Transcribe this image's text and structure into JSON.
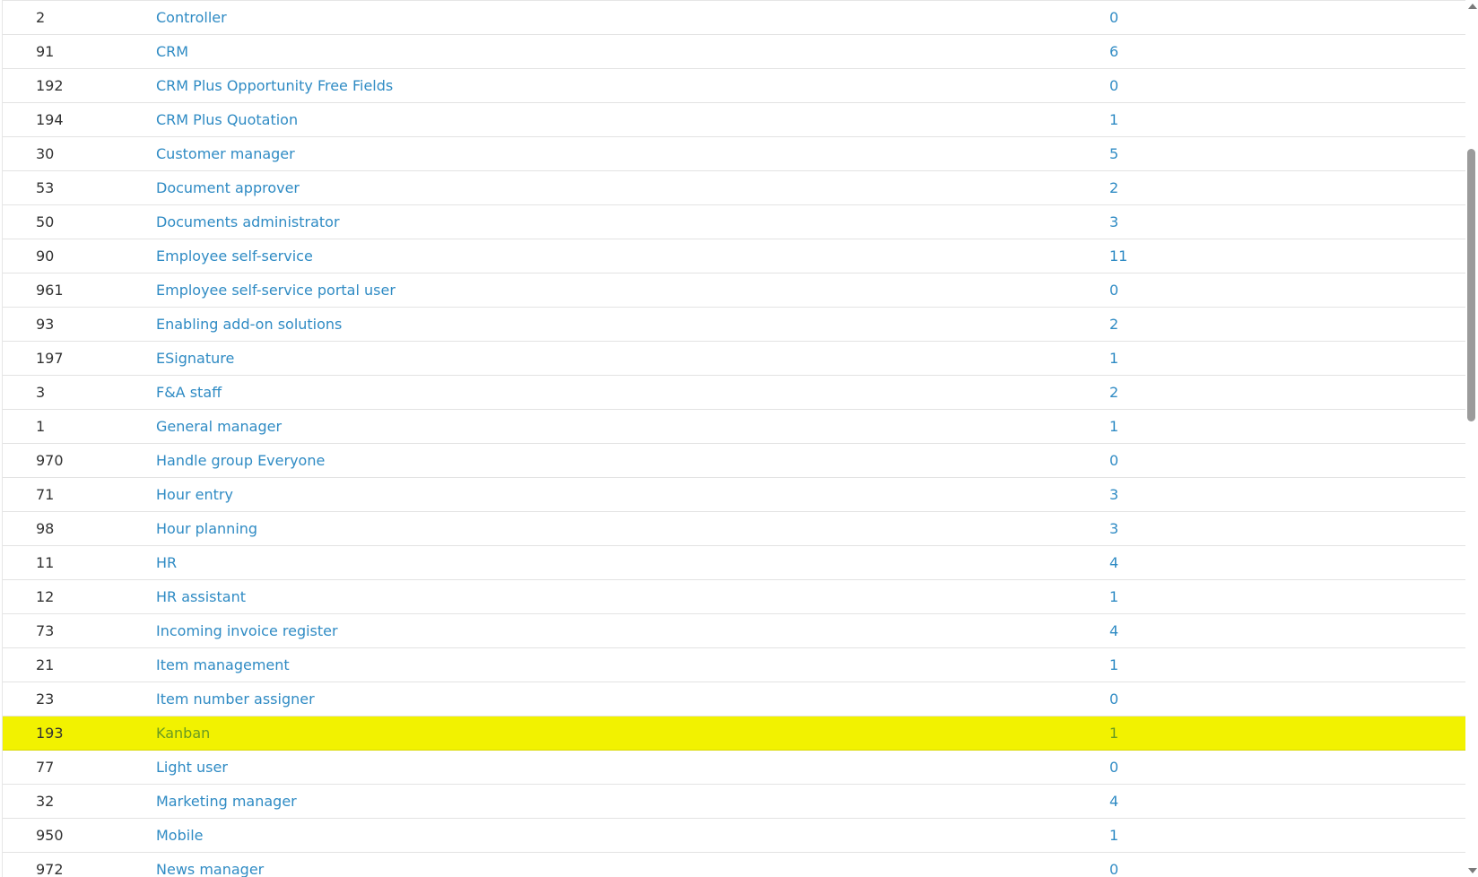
{
  "colors": {
    "link": "#2f8bc4",
    "text": "#333333",
    "highlight_bg": "#f2f200",
    "highlight_link": "#6a9b22",
    "row_border": "#e3e3e3"
  },
  "table": {
    "rows": [
      {
        "id": "2",
        "name": "Controller",
        "count": "0",
        "highlighted": false
      },
      {
        "id": "91",
        "name": "CRM",
        "count": "6",
        "highlighted": false
      },
      {
        "id": "192",
        "name": "CRM Plus Opportunity Free Fields",
        "count": "0",
        "highlighted": false
      },
      {
        "id": "194",
        "name": "CRM Plus Quotation",
        "count": "1",
        "highlighted": false
      },
      {
        "id": "30",
        "name": "Customer manager",
        "count": "5",
        "highlighted": false
      },
      {
        "id": "53",
        "name": "Document approver",
        "count": "2",
        "highlighted": false
      },
      {
        "id": "50",
        "name": "Documents administrator",
        "count": "3",
        "highlighted": false
      },
      {
        "id": "90",
        "name": "Employee self-service",
        "count": "11",
        "highlighted": false
      },
      {
        "id": "961",
        "name": "Employee self-service portal user",
        "count": "0",
        "highlighted": false
      },
      {
        "id": "93",
        "name": "Enabling add-on solutions",
        "count": "2",
        "highlighted": false
      },
      {
        "id": "197",
        "name": "ESignature",
        "count": "1",
        "highlighted": false
      },
      {
        "id": "3",
        "name": "F&A staff",
        "count": "2",
        "highlighted": false
      },
      {
        "id": "1",
        "name": "General manager",
        "count": "1",
        "highlighted": false
      },
      {
        "id": "970",
        "name": "Handle group Everyone",
        "count": "0",
        "highlighted": false
      },
      {
        "id": "71",
        "name": "Hour entry",
        "count": "3",
        "highlighted": false
      },
      {
        "id": "98",
        "name": "Hour planning",
        "count": "3",
        "highlighted": false
      },
      {
        "id": "11",
        "name": "HR",
        "count": "4",
        "highlighted": false
      },
      {
        "id": "12",
        "name": "HR assistant",
        "count": "1",
        "highlighted": false
      },
      {
        "id": "73",
        "name": "Incoming invoice register",
        "count": "4",
        "highlighted": false
      },
      {
        "id": "21",
        "name": "Item management",
        "count": "1",
        "highlighted": false
      },
      {
        "id": "23",
        "name": "Item number assigner",
        "count": "0",
        "highlighted": false
      },
      {
        "id": "193",
        "name": "Kanban",
        "count": "1",
        "highlighted": true
      },
      {
        "id": "77",
        "name": "Light user",
        "count": "0",
        "highlighted": false
      },
      {
        "id": "32",
        "name": "Marketing manager",
        "count": "4",
        "highlighted": false
      },
      {
        "id": "950",
        "name": "Mobile",
        "count": "1",
        "highlighted": false
      },
      {
        "id": "972",
        "name": "News manager",
        "count": "0",
        "highlighted": false
      }
    ]
  },
  "scrollbar": {
    "position_fraction": 0.16,
    "visible_fraction": 0.32
  }
}
